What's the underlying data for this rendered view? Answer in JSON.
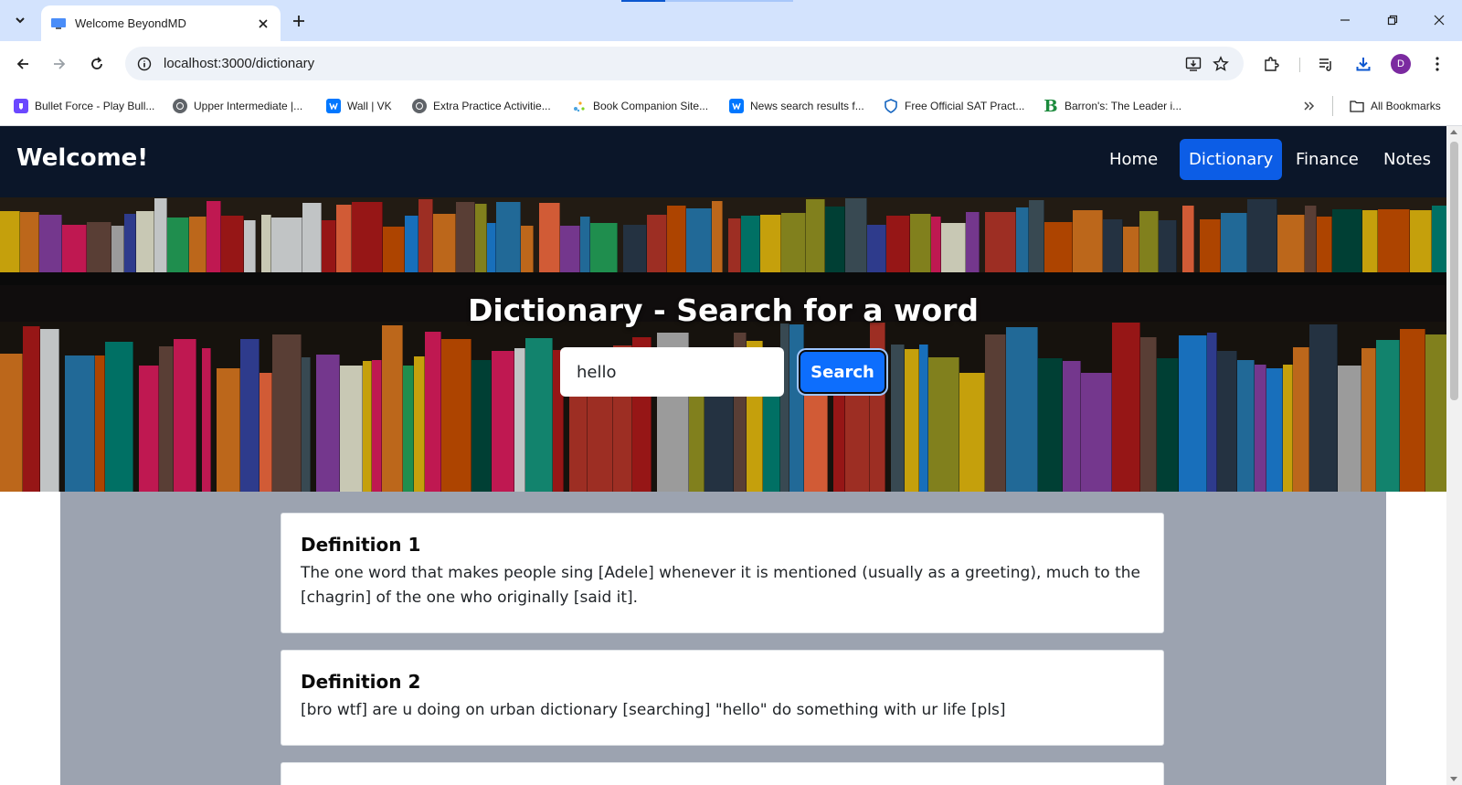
{
  "browser": {
    "tab_title": "Welcome BeyondMD",
    "url": "localhost:3000/dictionary",
    "bookmarks": [
      {
        "label": "Bullet Force - Play Bull...",
        "icon": "bullet-force-icon",
        "color": "#6b48ff"
      },
      {
        "label": "Upper Intermediate |...",
        "icon": "globe-icon",
        "color": "#5f6368"
      },
      {
        "label": "Wall | VK",
        "icon": "vk-icon",
        "color": "#0077ff"
      },
      {
        "label": "Extra Practice Activitie...",
        "icon": "globe-icon",
        "color": "#5f6368"
      },
      {
        "label": "Book Companion Site...",
        "icon": "sparkle-icon",
        "color": "#4aa3df"
      },
      {
        "label": "News search results f...",
        "icon": "vk-icon",
        "color": "#0077ff"
      },
      {
        "label": "Free Official SAT Pract...",
        "icon": "shield-icon",
        "color": "#1565c0"
      },
      {
        "label": "Barron's: The Leader i...",
        "icon": "barrons-icon",
        "color": "#1b8a3c"
      }
    ],
    "all_bookmarks_label": "All Bookmarks",
    "avatar_letter": "D"
  },
  "site": {
    "brand": "Welcome!",
    "nav": [
      {
        "label": "Home",
        "active": false
      },
      {
        "label": "Dictionary",
        "active": true
      },
      {
        "label": "Finance",
        "active": false
      },
      {
        "label": "Notes",
        "active": false
      }
    ]
  },
  "hero": {
    "title": "Dictionary - Search for a word",
    "search_value": "hello",
    "search_button": "Search"
  },
  "results": [
    {
      "heading": "Definition 1",
      "text": "The one word that makes people sing [Adele] whenever it is mentioned (usually as a greeting), much to the [chagrin] of the one who originally [said it]."
    },
    {
      "heading": "Definition 2",
      "text": "[bro wtf] are u doing on urban dictionary [searching] \"hello\" do something with ur life [pls]"
    }
  ],
  "colors": {
    "navbar": "#0b1629",
    "accent": "#0d6efd",
    "results_bg": "#9ca3b0"
  }
}
